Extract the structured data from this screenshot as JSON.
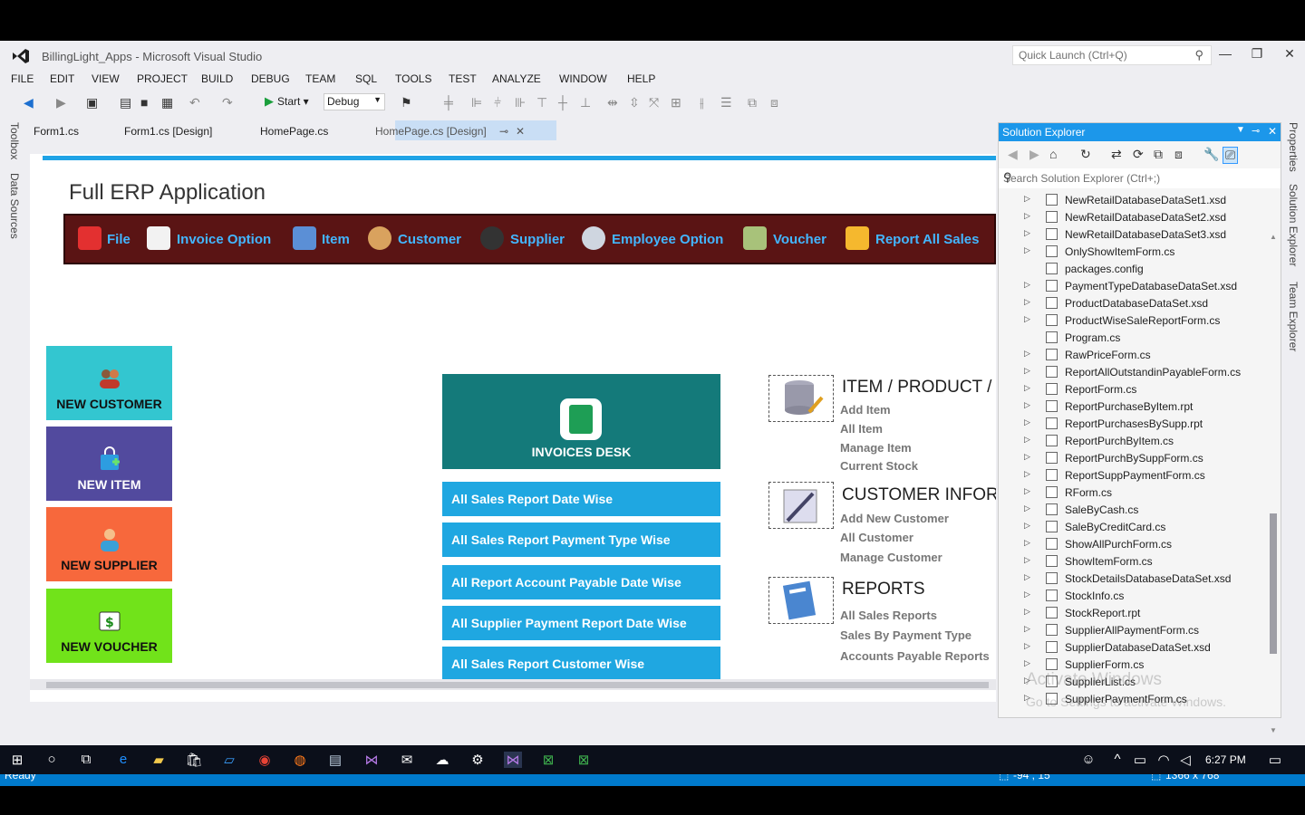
{
  "window": {
    "title": "BillingLight_Apps - Microsoft Visual Studio",
    "quick_launch_placeholder": "Quick Launch (Ctrl+Q)"
  },
  "menu": [
    "FILE",
    "EDIT",
    "VIEW",
    "PROJECT",
    "BUILD",
    "DEBUG",
    "TEAM",
    "SQL",
    "TOOLS",
    "TEST",
    "ANALYZE",
    "WINDOW",
    "HELP"
  ],
  "toolbar": {
    "start_label": "Start",
    "config": "Debug"
  },
  "side_tabs_left": [
    "Toolbox",
    "Data Sources"
  ],
  "side_tabs_right": [
    "Properties",
    "Solution Explorer",
    "Team Explorer"
  ],
  "doc_tabs": [
    "Form1.cs",
    "Form1.cs [Design]",
    "HomePage.cs",
    "HomePage.cs [Design]"
  ],
  "designer": {
    "app_title": "Full ERP Application",
    "erp_menu": [
      "File",
      "Invoice Option",
      "Item",
      "Customer",
      "Supplier",
      "Employee Option",
      "Voucher",
      "Report All Sales"
    ],
    "tiles": [
      {
        "label": "NEW CUSTOMER",
        "color": "#33c6d0"
      },
      {
        "label": "NEW ITEM",
        "color": "#524a9e"
      },
      {
        "label": "NEW SUPPLIER",
        "color": "#f7683c"
      },
      {
        "label": "NEW VOUCHER",
        "color": "#71e31a"
      }
    ],
    "invoice_desk": "INVOICES  DESK",
    "report_buttons": [
      "All Sales Report Date Wise",
      "All Sales Report Payment Type Wise",
      "All Report Account Payable Date Wise",
      "All Supplier Payment Report Date Wise",
      "All Sales Report Customer Wise"
    ],
    "sections": [
      {
        "title": "ITEM / PRODUCT / S",
        "links": [
          "Add Item",
          "All Item",
          "Manage Item",
          "Current Stock"
        ]
      },
      {
        "title": "CUSTOMER INFORM",
        "links": [
          "Add New Customer",
          "All Customer",
          "Manage Customer"
        ]
      },
      {
        "title": "REPORTS",
        "links": [
          "All Sales Reports",
          "Sales By Payment Type",
          "Accounts Payable Reports"
        ]
      }
    ]
  },
  "solution_explorer": {
    "title": "Solution Explorer",
    "search_placeholder": "Search Solution Explorer (Ctrl+;)",
    "items": [
      "NewRetailDatabaseDataSet1.xsd",
      "NewRetailDatabaseDataSet2.xsd",
      "NewRetailDatabaseDataSet3.xsd",
      "OnlyShowItemForm.cs",
      "packages.config",
      "PaymentTypeDatabaseDataSet.xsd",
      "ProductDatabaseDataSet.xsd",
      "ProductWiseSaleReportForm.cs",
      "Program.cs",
      "RawPriceForm.cs",
      "ReportAllOutstandinPayableForm.cs",
      "ReportForm.cs",
      "ReportPurchaseByItem.rpt",
      "ReportPurchasesBySupp.rpt",
      "ReportPurchByItem.cs",
      "ReportPurchBySuppForm.cs",
      "ReportSuppPaymentForm.cs",
      "RForm.cs",
      "SaleByCash.cs",
      "SaleByCreditCard.cs",
      "ShowAllPurchForm.cs",
      "ShowItemForm.cs",
      "StockDetailsDatabaseDataSet.xsd",
      "StockInfo.cs",
      "StockReport.rpt",
      "SupplierAllPaymentForm.cs",
      "SupplierDatabaseDataSet.xsd",
      "SupplierForm.cs",
      "SupplierList.cs",
      "SupplierPaymentForm.cs"
    ]
  },
  "watermark": {
    "line1": "Activate Windows",
    "line2": "Go to Settings to activate Windows."
  },
  "status": {
    "state": "Ready",
    "position": "-94 , 15",
    "size": "1366 x 768"
  },
  "taskbar": {
    "time": "6:27 PM"
  }
}
